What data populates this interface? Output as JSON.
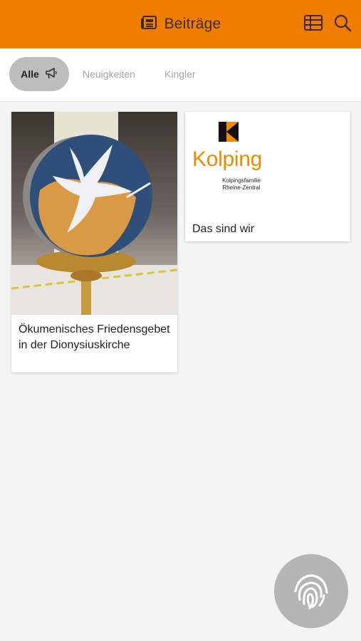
{
  "header": {
    "title": "Beiträge",
    "icons": [
      "newspaper-icon",
      "table-icon",
      "search-icon"
    ]
  },
  "tabs": [
    {
      "label": "Alle",
      "icon": "megaphone-icon",
      "active": true
    },
    {
      "label": "Neuigkeiten",
      "active": false
    },
    {
      "label": "Kingler",
      "active": false
    }
  ],
  "posts": [
    {
      "title": "Ökumenisches Friedensgebet in der Dionysiuskirche",
      "image": "dove-on-candle-photo"
    },
    {
      "title": "Das sind wir",
      "image": "kolping-logo",
      "logo_text": "Kolping",
      "logo_sub_line1": "Kolpingsfamilie",
      "logo_sub_line2": "Rheine-Zentral"
    }
  ],
  "fab": {
    "icon": "fingerprint-icon"
  },
  "colors": {
    "accent": "#f07d00",
    "background": "#f4f4f4",
    "fab": "#b5b5b5"
  }
}
